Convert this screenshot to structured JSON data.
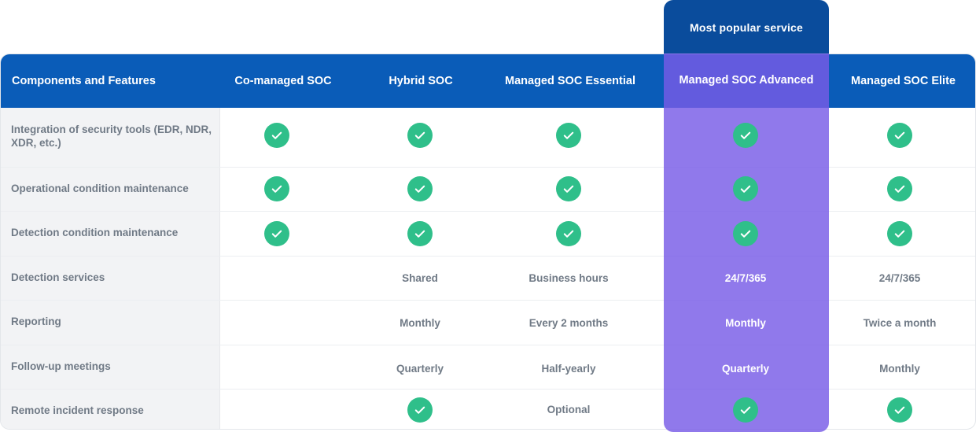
{
  "badge": {
    "label": "Most popular service"
  },
  "header": {
    "features_label": "Components and Features",
    "columns": [
      "Co-managed SOC",
      "Hybrid SOC",
      "Managed SOC Essential",
      "Managed SOC Advanced",
      "Managed SOC Elite"
    ]
  },
  "rows": [
    {
      "label": "Integration of security tools (EDR, NDR, XDR, etc.)",
      "values": [
        "check",
        "check",
        "check",
        "check",
        "check"
      ]
    },
    {
      "label": "Operational condition maintenance",
      "values": [
        "check",
        "check",
        "check",
        "check",
        "check"
      ]
    },
    {
      "label": "Detection condition maintenance",
      "values": [
        "check",
        "check",
        "check",
        "check",
        "check"
      ]
    },
    {
      "label": "Detection services",
      "values": [
        "",
        "Shared",
        "Business hours",
        "24/7/365",
        "24/7/365"
      ]
    },
    {
      "label": "Reporting",
      "values": [
        "",
        "Monthly",
        "Every 2 months",
        "Monthly",
        "Twice a month"
      ]
    },
    {
      "label": "Follow-up meetings",
      "values": [
        "",
        "Quarterly",
        "Half-yearly",
        "Quarterly",
        "Monthly"
      ]
    },
    {
      "label": "Remote incident response",
      "values": [
        "",
        "check",
        "Optional",
        "check",
        "check"
      ]
    }
  ],
  "icons": {
    "check": "check-circle-icon"
  },
  "colors": {
    "header_blue": "#0a5cb8",
    "badge_blue": "#0a4c9c",
    "highlight_purple": "#8a73e8",
    "check_green": "#2fbf8a",
    "label_gray": "#707a86"
  }
}
